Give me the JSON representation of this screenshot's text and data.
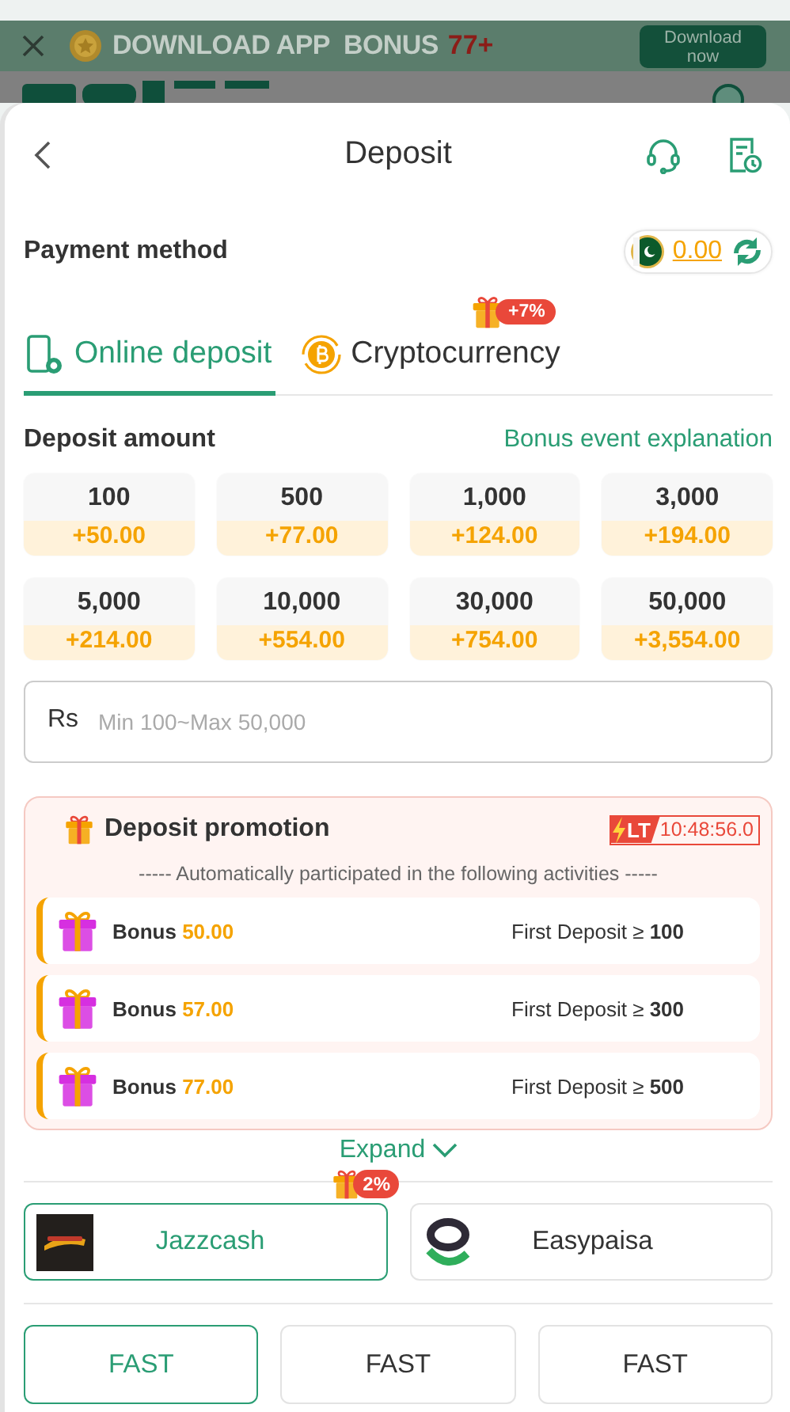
{
  "banner": {
    "text": "DOWNLOAD APP  BONUS",
    "bonus": "77+",
    "button": "Download now"
  },
  "header": {
    "title": "Deposit"
  },
  "payment_method": {
    "label": "Payment method",
    "balance": "0.00"
  },
  "tabs": [
    {
      "label": "Online deposit",
      "selected": true,
      "kind": "phone"
    },
    {
      "label": "Cryptocurrency",
      "selected": false,
      "kind": "coin",
      "badge": "+7%"
    }
  ],
  "amount": {
    "label": "Deposit amount",
    "link": "Bonus event explanation",
    "currency": "Rs",
    "placeholder": "Min 100~Max 50,000",
    "options": [
      {
        "amount": "100",
        "bonus": "+50.00"
      },
      {
        "amount": "500",
        "bonus": "+77.00"
      },
      {
        "amount": "1,000",
        "bonus": "+124.00"
      },
      {
        "amount": "3,000",
        "bonus": "+194.00"
      },
      {
        "amount": "5,000",
        "bonus": "+214.00"
      },
      {
        "amount": "10,000",
        "bonus": "+554.00"
      },
      {
        "amount": "30,000",
        "bonus": "+754.00"
      },
      {
        "amount": "50,000",
        "bonus": "+3,554.00"
      }
    ]
  },
  "promotion": {
    "title": "Deposit promotion",
    "timer_tag": "LT",
    "timer": "10:48:56.0",
    "subtitle": "----- Automatically participated in the following activities -----",
    "items": [
      {
        "label": "Bonus",
        "amount": "50.00",
        "condition": "First Deposit ≥ **100**"
      },
      {
        "label": "Bonus",
        "amount": "57.00",
        "condition": "First Deposit ≥ **300**"
      },
      {
        "label": "Bonus",
        "amount": "77.00",
        "condition": "First Deposit ≥ **500**"
      }
    ]
  },
  "expand": "Expand",
  "channels": [
    {
      "name": "Jazzcash",
      "selected": true,
      "kind": "jazzcash",
      "badge": "2%"
    },
    {
      "name": "Easypaisa",
      "selected": false,
      "kind": "easypaisa"
    }
  ],
  "speeds": [
    {
      "label": "FAST",
      "selected": true
    },
    {
      "label": "FAST",
      "selected": false
    },
    {
      "label": "FAST",
      "selected": false
    }
  ]
}
